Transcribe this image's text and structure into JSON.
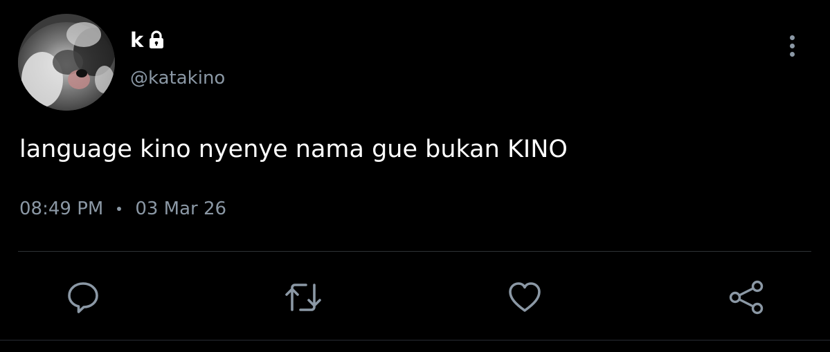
{
  "tweet": {
    "author": {
      "display_name": "k",
      "handle": "@katakino",
      "protected_icon": "lock-icon",
      "avatar": "avatar-photo"
    },
    "text": "language kino nyenye nama gue bukan KINO",
    "time": "08:49 PM",
    "date": "03 Mar 26",
    "menu_icon": "more-vertical-icon"
  },
  "actions": [
    {
      "name": "reply",
      "icon": "reply-icon"
    },
    {
      "name": "retweet",
      "icon": "retweet-icon"
    },
    {
      "name": "like",
      "icon": "heart-icon"
    },
    {
      "name": "share",
      "icon": "share-icon"
    }
  ],
  "colors": {
    "background": "#000000",
    "text_primary": "#ffffff",
    "text_secondary": "#8b98a5",
    "divider": "#2f3336"
  }
}
